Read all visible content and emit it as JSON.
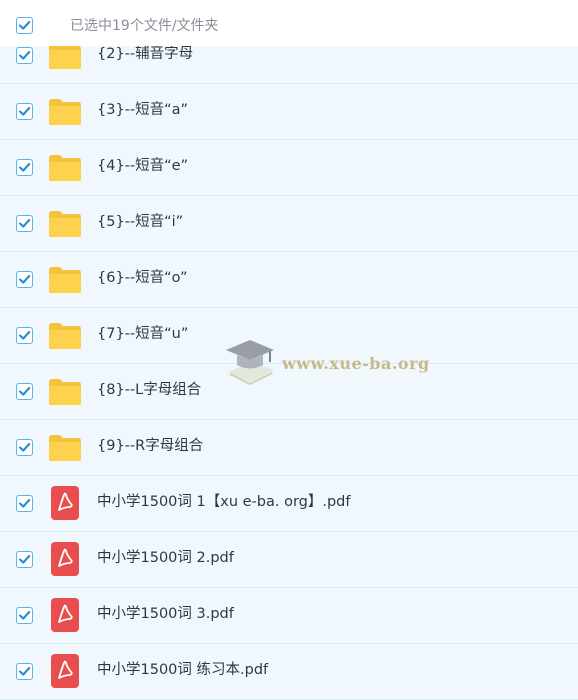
{
  "header": {
    "selection_text": "已选中19个文件/文件夹",
    "select_all_checked": true
  },
  "items": [
    {
      "name": "{2}--辅音字母",
      "type": "folder",
      "checked": true
    },
    {
      "name": "{3}--短音“a”",
      "type": "folder",
      "checked": true
    },
    {
      "name": "{4}--短音“e”",
      "type": "folder",
      "checked": true
    },
    {
      "name": "{5}--短音“i”",
      "type": "folder",
      "checked": true
    },
    {
      "name": "{6}--短音“o”",
      "type": "folder",
      "checked": true
    },
    {
      "name": "{7}--短音“u”",
      "type": "folder",
      "checked": true
    },
    {
      "name": "{8}--L字母组合",
      "type": "folder",
      "checked": true
    },
    {
      "name": "{9}--R字母组合",
      "type": "folder",
      "checked": true
    },
    {
      "name": "中小学1500词 1【xu e-ba. org】.pdf",
      "type": "pdf",
      "checked": true
    },
    {
      "name": "中小学1500词 2.pdf",
      "type": "pdf",
      "checked": true
    },
    {
      "name": "中小学1500词 3.pdf",
      "type": "pdf",
      "checked": true
    },
    {
      "name": "中小学1500词 练习本.pdf",
      "type": "pdf",
      "checked": true
    }
  ],
  "watermark": {
    "text": "www.xue-ba.org",
    "icon": "graduation-cap-icon"
  },
  "colors": {
    "checkbox_check": "#2a8fd8",
    "folder": "#ffd24d",
    "pdf": "#e94e4e",
    "row_bg": "#f0f8fe"
  }
}
